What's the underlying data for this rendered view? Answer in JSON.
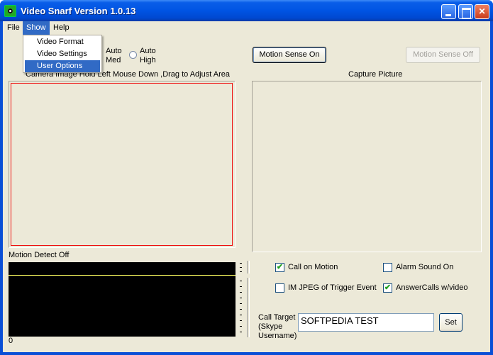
{
  "window": {
    "title": "Video Snarf Version 1.0.13"
  },
  "menubar": {
    "file": "File",
    "show": "Show",
    "help": "Help"
  },
  "show_menu": {
    "items": [
      "Video Format",
      "Video Settings",
      "User Options"
    ]
  },
  "sensitivity": {
    "auto_med_line1": "Auto",
    "auto_med_line2": "Med",
    "auto_high_line1": "Auto",
    "auto_high_line2": "High"
  },
  "buttons": {
    "motion_on": "Motion Sense On",
    "motion_off": "Motion Sense Off",
    "set": "Set"
  },
  "camera": {
    "label": "Camera Image  Hold Left Mouse Down ,Drag to Adjust Area"
  },
  "capture": {
    "label": "Capture Picture"
  },
  "motion_detect": {
    "status": "Motion Detect Off",
    "level": "0"
  },
  "options": {
    "call_on_motion": "Call on Motion",
    "alarm_sound_on": "Alarm Sound On",
    "im_jpeg": "IM JPEG of Trigger Event",
    "answer_calls": "AnswerCalls w/video",
    "call_on_motion_checked": true,
    "alarm_sound_on_checked": false,
    "im_jpeg_checked": false,
    "answer_calls_checked": true
  },
  "call_target": {
    "label_line1": "Call Target",
    "label_line2": "(Skype",
    "label_line3": "Username)",
    "value": "SOFTPEDIA TEST"
  },
  "colors": {
    "accent": "#316ac5",
    "frame": "#ee1010",
    "level_line": "#ffff60"
  }
}
